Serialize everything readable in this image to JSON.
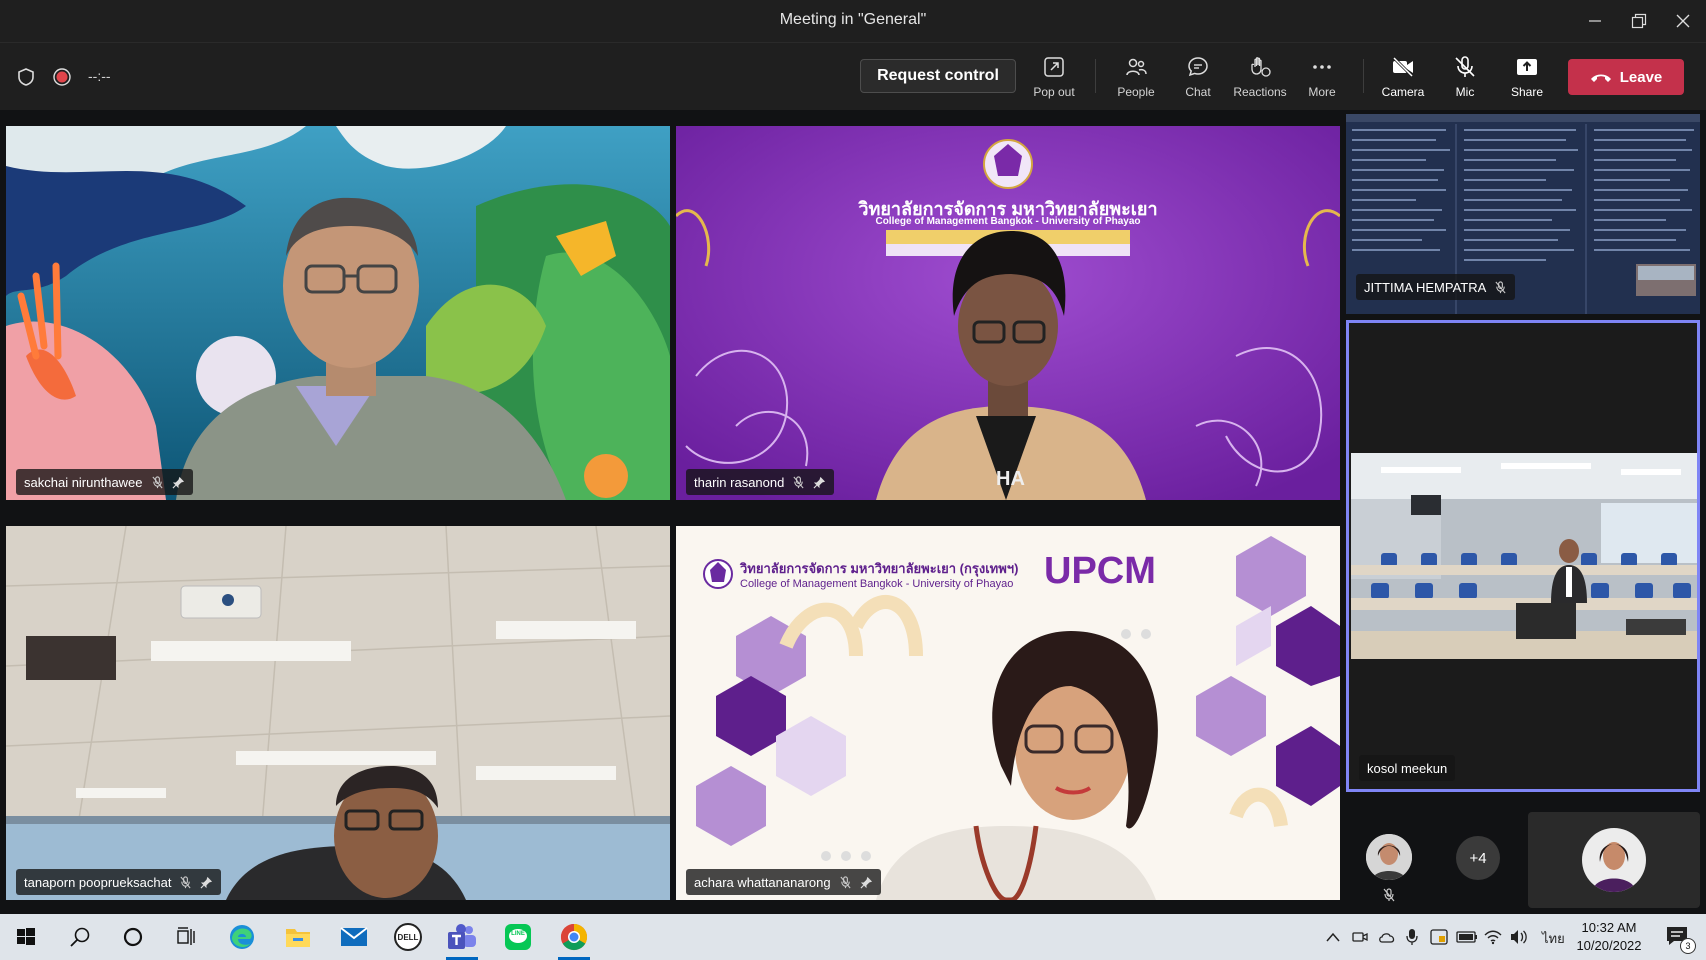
{
  "window": {
    "title": "Meeting in \"General\"",
    "controls": [
      "minimize",
      "restore",
      "close"
    ]
  },
  "toolbar": {
    "timer": "--:--",
    "request_control": "Request control",
    "buttons": {
      "popout": "Pop out",
      "people": "People",
      "chat": "Chat",
      "reactions": "Reactions",
      "more": "More",
      "camera": "Camera",
      "mic": "Mic",
      "share": "Share"
    },
    "leave": "Leave",
    "leave_color": "#c4314b"
  },
  "participants": {
    "tile1": {
      "name": "sakchai nirunthawee",
      "muted": true,
      "pinned": true
    },
    "tile2": {
      "name": "tharin rasanond",
      "muted": true,
      "pinned": true,
      "bg_title_th": "วิทยาลัยการจัดการ มหาวิทยาลัยพะเยา",
      "bg_title_en": "College of Management Bangkok - University of Phayao",
      "shirt_text": "HA"
    },
    "tile3": {
      "name": "tanaporn pooprueksachat",
      "muted": true,
      "pinned": true
    },
    "tile4": {
      "name": "achara whattananarong",
      "muted": true,
      "pinned": true,
      "bg_title_th": "วิทยาลัยการจัดการ มหาวิทยาลัยพะเยา (กรุงเทพฯ)",
      "bg_title_en": "College of Management Bangkok - University of Phayao",
      "bg_logo_text": "UPCM"
    },
    "side1": {
      "name": "JITTIMA HEMPATRA",
      "muted": true
    },
    "side2": {
      "name": "kosol meekun",
      "highlight_color": "#7f85f5"
    },
    "overflow_count": "+4"
  },
  "taskbar": {
    "apps": [
      "start-icon",
      "search-icon",
      "cortana-icon",
      "task-view-icon",
      "edge-icon",
      "file-explorer-icon",
      "mail-icon",
      "dell-icon",
      "teams-icon",
      "line-icon",
      "chrome-icon"
    ],
    "dell_label": "DELL",
    "line_label": "LINE",
    "language": "ไทย",
    "time": "10:32 AM",
    "date": "10/20/2022",
    "notification_count": "3"
  }
}
